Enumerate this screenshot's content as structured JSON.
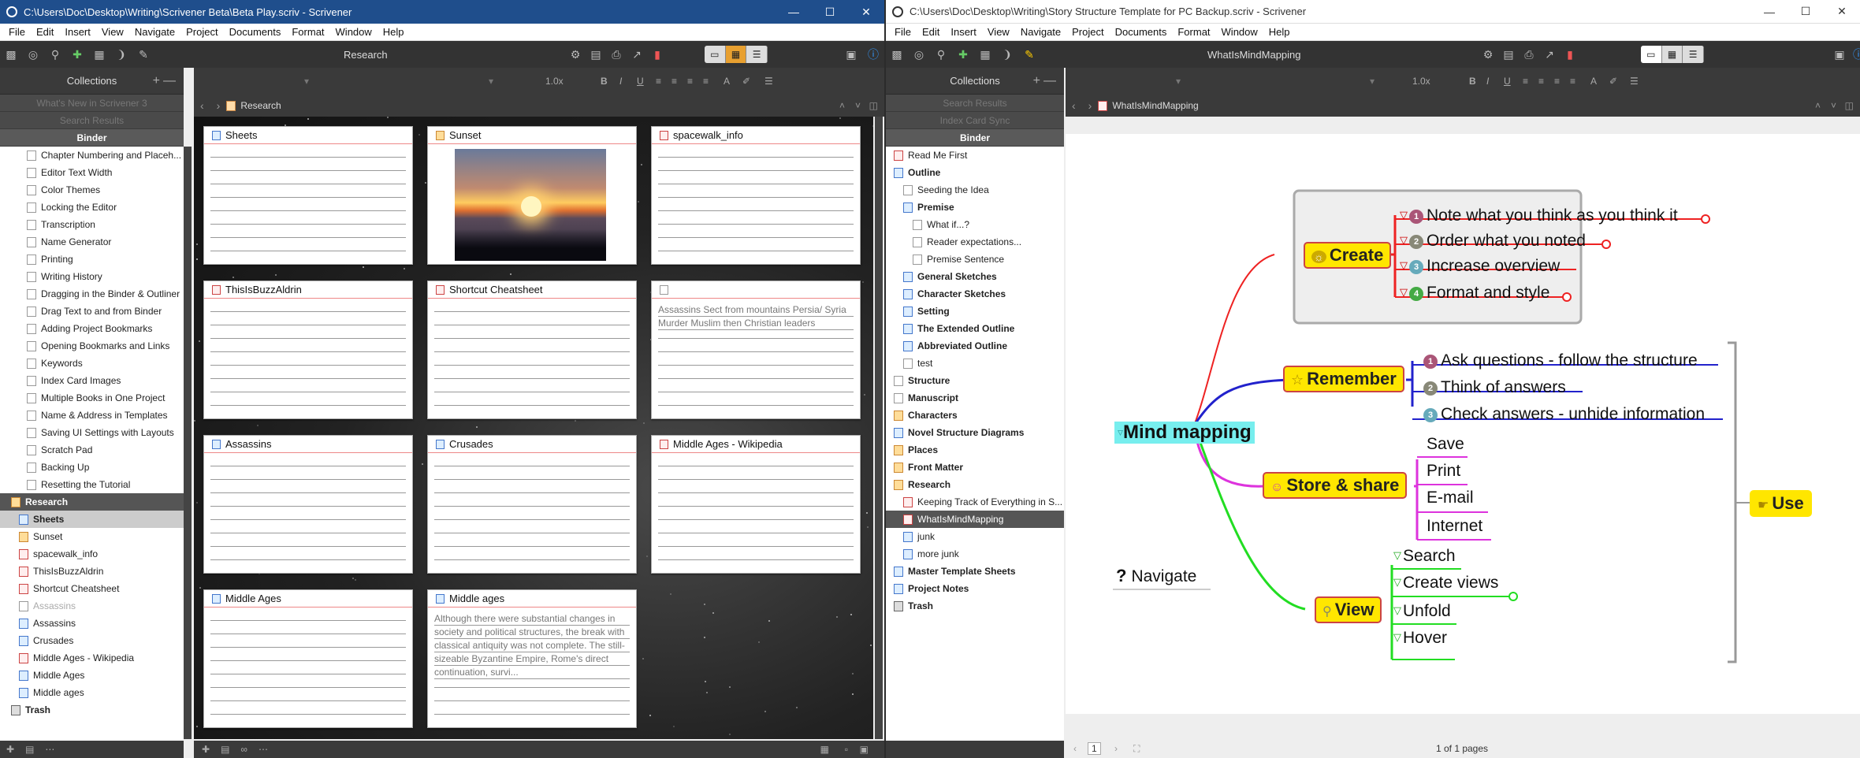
{
  "window1": {
    "title": "C:\\Users\\Doc\\Desktop\\Writing\\Scrivener Beta\\Beta Play.scriv - Scrivener",
    "menu": [
      "File",
      "Edit",
      "Insert",
      "View",
      "Navigate",
      "Project",
      "Documents",
      "Format",
      "Window",
      "Help"
    ],
    "toolbar_title": "Research",
    "zoom": "1.0x",
    "sidebar_header": "Collections",
    "collections": [
      "What's New in Scrivener 3",
      "Search Results",
      "Binder"
    ],
    "binder_items": [
      "Chapter Numbering and Placeh...",
      "Editor Text Width",
      "Color Themes",
      "Locking the Editor",
      "Transcription",
      "Name Generator",
      "Printing",
      "Writing History",
      "Dragging in the Binder & Outliner",
      "Drag Text to and from Binder",
      "Adding Project Bookmarks",
      "Opening Bookmarks and Links",
      "Keywords",
      "Index Card Images",
      "Multiple Books in One Project",
      "Name & Address in Templates",
      "Saving UI Settings with Layouts",
      "Scratch Pad",
      "Backing Up",
      "Resetting the Tutorial"
    ],
    "research": "Research",
    "research_items": [
      "Sheets",
      "Sunset",
      "spacewalk_info",
      "ThisIsBuzzAldrin",
      "Shortcut Cheatsheet",
      "Assassins",
      "Assassins",
      "Crusades",
      "Middle Ages - Wikipedia",
      "Middle Ages",
      "Middle ages"
    ],
    "trash": "Trash",
    "path": "Research",
    "cards": [
      {
        "title": "Sheets",
        "synopsis": ""
      },
      {
        "title": "Sunset",
        "synopsis": ""
      },
      {
        "title": "spacewalk_info",
        "synopsis": ""
      },
      {
        "title": "ThisIsBuzzAldrin",
        "synopsis": ""
      },
      {
        "title": "Shortcut Cheatsheet",
        "synopsis": ""
      },
      {
        "title": "",
        "synopsis": "Assassins Sect from mountains Persia/ Syria Murder Muslim then Christian leaders"
      },
      {
        "title": "Assassins",
        "synopsis": ""
      },
      {
        "title": "Crusades",
        "synopsis": ""
      },
      {
        "title": "Middle Ages - Wikipedia",
        "synopsis": ""
      },
      {
        "title": "Middle Ages",
        "synopsis": ""
      },
      {
        "title": "Middle ages",
        "synopsis": "Although there were substantial changes in society and political structures, the break with classical antiquity was not complete. The still-sizeable Byzantine Empire, Rome's direct continuation, survi..."
      }
    ]
  },
  "window2": {
    "title": "C:\\Users\\Doc\\Desktop\\Writing\\Story Structure Template for PC Backup.scriv - Scrivener",
    "menu": [
      "File",
      "Edit",
      "Insert",
      "View",
      "Navigate",
      "Project",
      "Documents",
      "Format",
      "Window",
      "Help"
    ],
    "toolbar_title": "WhatIsMindMapping",
    "zoom": "1.0x",
    "sidebar_header": "Collections",
    "collections": [
      "Search Results",
      "Index Card Sync",
      "Binder"
    ],
    "binder_items": [
      {
        "label": "Read Me First",
        "level": 0,
        "bold": false
      },
      {
        "label": "Outline",
        "level": 0,
        "bold": true
      },
      {
        "label": "Seeding the Idea",
        "level": 1,
        "bold": false
      },
      {
        "label": "Premise",
        "level": 1,
        "bold": true
      },
      {
        "label": "What if...?",
        "level": 2,
        "bold": false
      },
      {
        "label": "Reader expectations...",
        "level": 2,
        "bold": false
      },
      {
        "label": "Premise Sentence",
        "level": 2,
        "bold": false
      },
      {
        "label": "General Sketches",
        "level": 1,
        "bold": true
      },
      {
        "label": "Character Sketches",
        "level": 1,
        "bold": true
      },
      {
        "label": "Setting",
        "level": 1,
        "bold": true
      },
      {
        "label": "The Extended Outline",
        "level": 1,
        "bold": true
      },
      {
        "label": "Abbreviated Outline",
        "level": 1,
        "bold": true
      },
      {
        "label": "test",
        "level": 1,
        "bold": false
      },
      {
        "label": "Structure",
        "level": 0,
        "bold": true
      },
      {
        "label": "Manuscript",
        "level": 0,
        "bold": true
      },
      {
        "label": "Characters",
        "level": 0,
        "bold": true
      },
      {
        "label": "Novel Structure Diagrams",
        "level": 0,
        "bold": true
      },
      {
        "label": "Places",
        "level": 0,
        "bold": true
      },
      {
        "label": "Front Matter",
        "level": 0,
        "bold": true
      },
      {
        "label": "Research",
        "level": 0,
        "bold": true
      },
      {
        "label": "Keeping Track of Everything in S...",
        "level": 1,
        "bold": false
      },
      {
        "label": "WhatIsMindMapping",
        "level": 1,
        "bold": false,
        "selected": true
      },
      {
        "label": "junk",
        "level": 1,
        "bold": false
      },
      {
        "label": "more junk",
        "level": 1,
        "bold": false
      },
      {
        "label": "Master Template Sheets",
        "level": 0,
        "bold": true
      },
      {
        "label": "Project Notes",
        "level": 0,
        "bold": true
      },
      {
        "label": "Trash",
        "level": 0,
        "bold": true
      }
    ],
    "path": "WhatIsMindMapping",
    "page_status": "1 of 1 pages",
    "page_num": "1",
    "mindmap": {
      "center": "Mind mapping",
      "create": "Create",
      "create_items": [
        "Note what you think as you think it",
        "Order what you noted",
        "Increase overview",
        "Format and style"
      ],
      "remember": "Remember",
      "remember_items": [
        "Ask questions - follow the structure",
        "Think of answers",
        "Check answers - unhide information"
      ],
      "store": "Store & share",
      "store_items": [
        "Save",
        "Print",
        "E-mail",
        "Internet"
      ],
      "view": "View",
      "view_items": [
        "Search",
        "Create views",
        "Unfold",
        "Hover"
      ],
      "use": "Use",
      "navigate": "Navigate",
      "badges": [
        "1",
        "2",
        "3",
        "4"
      ]
    }
  }
}
